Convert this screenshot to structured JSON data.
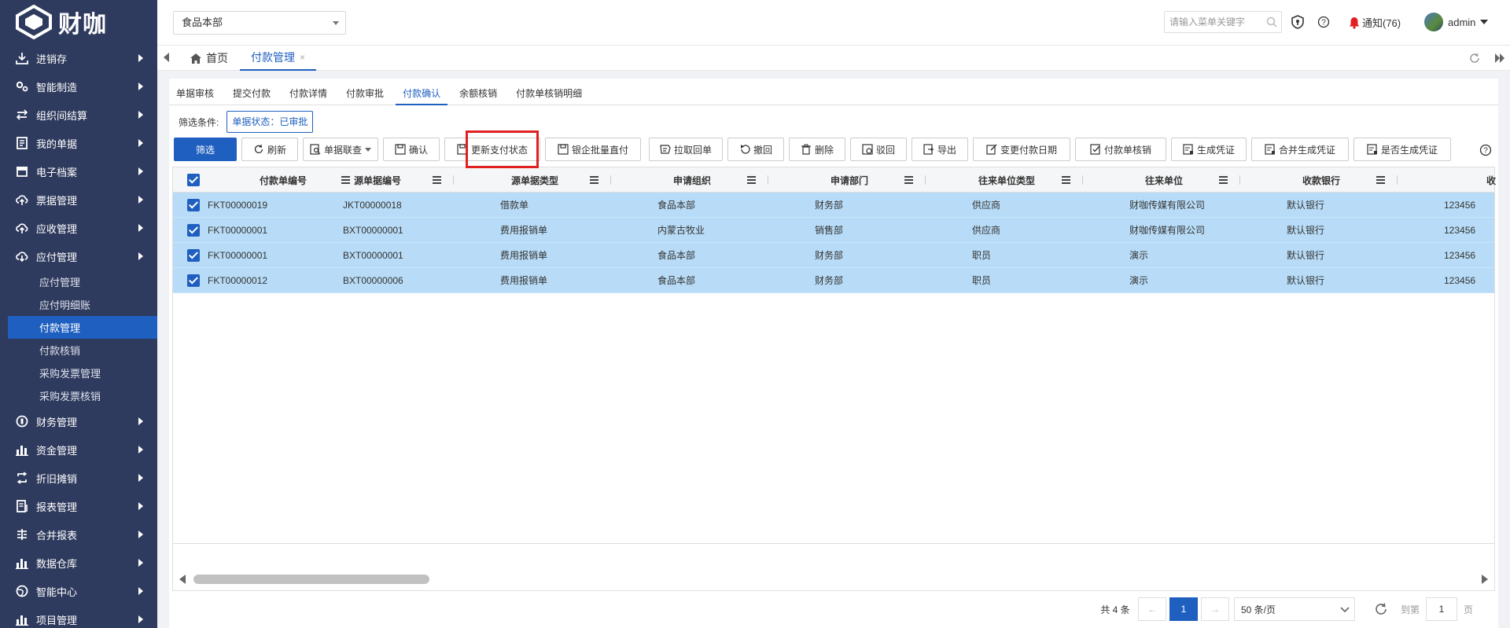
{
  "brand": {
    "name": "财咖"
  },
  "sidebar": {
    "items": [
      {
        "label": "进销存",
        "icon": "download-icon"
      },
      {
        "label": "智能制造",
        "icon": "gears-icon"
      },
      {
        "label": "组织间结算",
        "icon": "exchange-icon"
      },
      {
        "label": "我的单据",
        "icon": "document-icon"
      },
      {
        "label": "电子档案",
        "icon": "archive-icon"
      },
      {
        "label": "票据管理",
        "icon": "cloud-upload-icon"
      },
      {
        "label": "应收管理",
        "icon": "cloud-upload-icon"
      },
      {
        "label": "应付管理",
        "icon": "cloud-download-icon"
      }
    ],
    "sub_items": [
      {
        "label": "应付管理",
        "active": false
      },
      {
        "label": "应付明细账",
        "active": false
      },
      {
        "label": "付款管理",
        "active": true
      },
      {
        "label": "付款核销",
        "active": false
      },
      {
        "label": "采购发票管理",
        "active": false
      },
      {
        "label": "采购发票核销",
        "active": false
      }
    ],
    "items_after": [
      {
        "label": "财务管理",
        "icon": "coin-icon"
      },
      {
        "label": "资金管理",
        "icon": "bar-chart-icon"
      },
      {
        "label": "折旧摊销",
        "icon": "cycle-icon"
      },
      {
        "label": "报表管理",
        "icon": "report-icon"
      },
      {
        "label": "合并报表",
        "icon": "merge-icon"
      },
      {
        "label": "数据仓库",
        "icon": "bar-chart-icon"
      },
      {
        "label": "智能中心",
        "icon": "globe-icon"
      },
      {
        "label": "项目管理",
        "icon": "bar-chart-icon"
      }
    ]
  },
  "header": {
    "org_select": "食品本部",
    "search_placeholder": "请输入菜单关键字",
    "notify_label": "通知(76)",
    "user_name": "admin"
  },
  "tabs": {
    "home": "首页",
    "current": "付款管理",
    "close": "×"
  },
  "subtabs": [
    {
      "label": "单据审核",
      "active": false
    },
    {
      "label": "提交付款",
      "active": false
    },
    {
      "label": "付款详情",
      "active": false
    },
    {
      "label": "付款审批",
      "active": false
    },
    {
      "label": "付款确认",
      "active": true
    },
    {
      "label": "余额核销",
      "active": false
    },
    {
      "label": "付款单核销明细",
      "active": false
    }
  ],
  "filter": {
    "label": "筛选条件:",
    "tag": "单据状态：已审批"
  },
  "toolbar": {
    "filter": "筛选",
    "refresh": "刷新",
    "linked": "单据联查",
    "confirm": "确认",
    "update_status": "更新支付状态",
    "bank_direct": "银企批量直付",
    "pull_receipt": "拉取回单",
    "withdraw": "撤回",
    "delete": "删除",
    "reject": "驳回",
    "export": "导出",
    "change_date": "变更付款日期",
    "verify": "付款单核销",
    "gen_voucher": "生成凭证",
    "merge_voucher": "合并生成凭证",
    "is_voucher": "是否生成凭证"
  },
  "grid": {
    "columns": [
      "付款单编号",
      "源单据编号",
      "源单据类型",
      "申请组织",
      "申请部门",
      "往来单位类型",
      "往来单位",
      "收款银行",
      "收"
    ],
    "rows": [
      [
        "FKT00000019",
        "JKT00000018",
        "借款单",
        "食品本部",
        "财务部",
        "供应商",
        "财咖传媒有限公司",
        "默认银行",
        "123456"
      ],
      [
        "FKT00000001",
        "BXT00000001",
        "费用报销单",
        "内蒙古牧业",
        "销售部",
        "供应商",
        "财咖传媒有限公司",
        "默认银行",
        "123456"
      ],
      [
        "FKT00000001",
        "BXT00000001",
        "费用报销单",
        "食品本部",
        "财务部",
        "职员",
        "演示",
        "默认银行",
        "123456"
      ],
      [
        "FKT00000012",
        "BXT00000006",
        "费用报销单",
        "食品本部",
        "财务部",
        "职员",
        "演示",
        "默认银行",
        "123456"
      ]
    ]
  },
  "pager": {
    "total": "共 4 条",
    "current_page": "1",
    "page_size": "50 条/页",
    "goto_label": "到第",
    "goto_value": "1",
    "page_suffix": "页",
    "prev": "←",
    "next": "→"
  },
  "colors": {
    "sidebar": "#2f3b5e",
    "accent": "#1f5fbf",
    "row_selected": "#b8dcf7",
    "highlight": "#e02020"
  }
}
